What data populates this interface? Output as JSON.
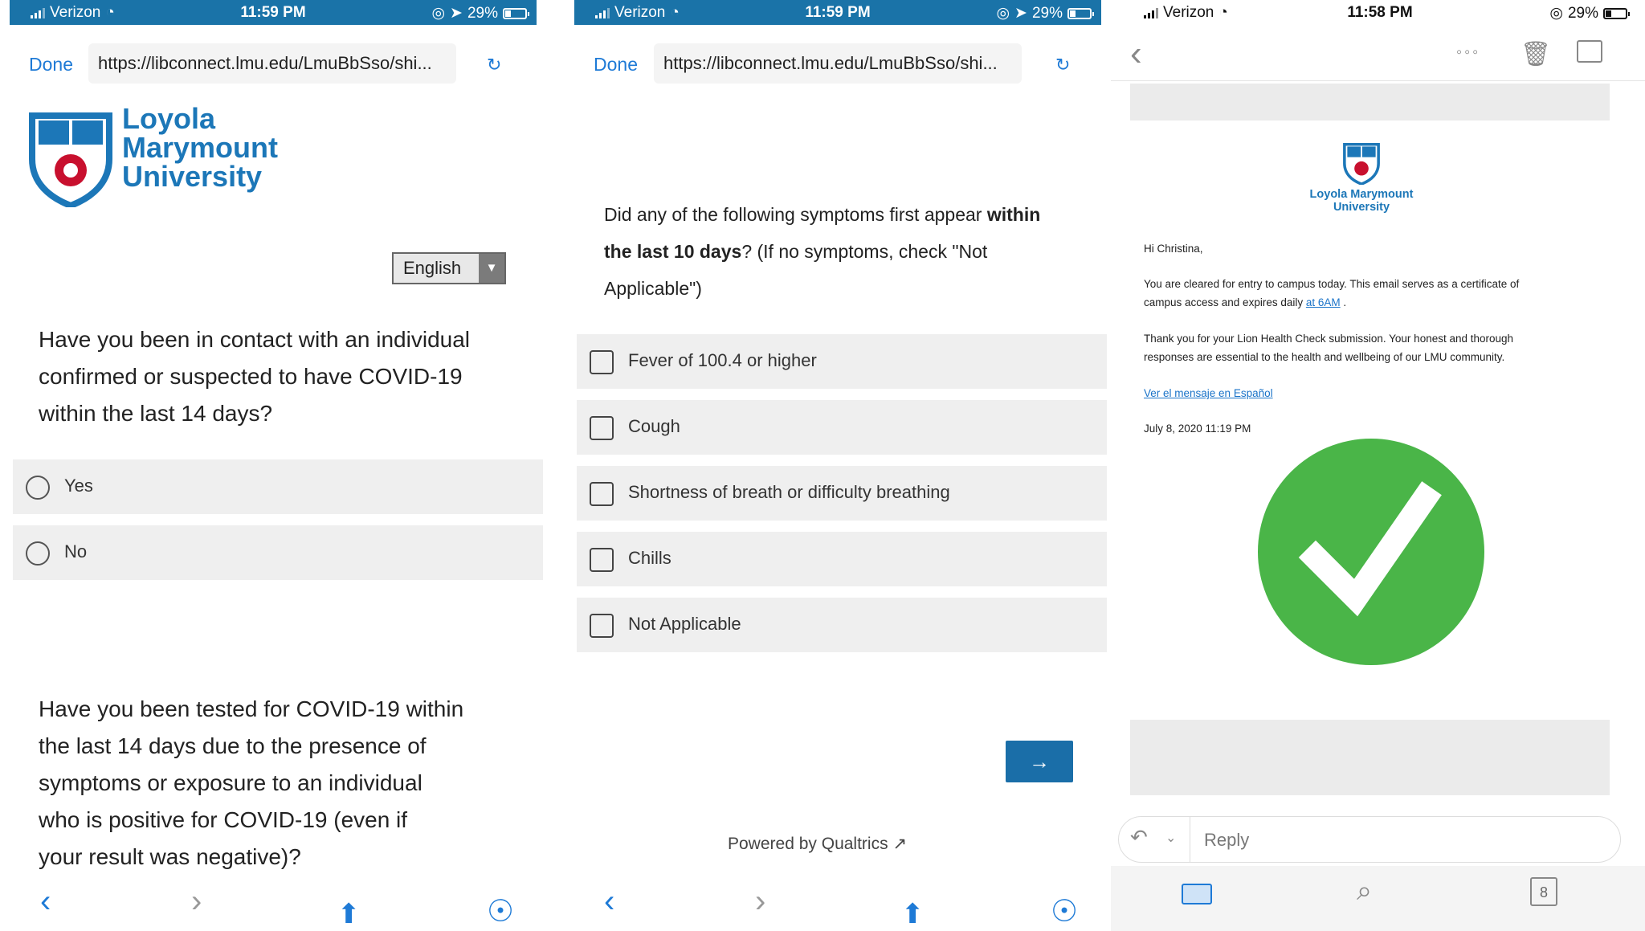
{
  "status_left": {
    "carrier": "Verizon",
    "time": "11:59 PM",
    "battery": "29%"
  },
  "status_mid": {
    "carrier": "Verizon",
    "time": "11:59 PM",
    "battery": "29%"
  },
  "status_right": {
    "carrier": "Verizon",
    "time": "11:58 PM",
    "battery": "29%"
  },
  "browser": {
    "done_label": "Done",
    "url": "https://libconnect.lmu.edu/LmuBbSso/shi..."
  },
  "logo": {
    "line1": "Loyola",
    "line2": "Marymount",
    "line3": "University"
  },
  "language": {
    "selected": "English"
  },
  "survey1": {
    "q1": {
      "lines": [
        "Have you been in contact with an individual",
        "confirmed or suspected to have COVID-19",
        "within the last 14 days?"
      ]
    },
    "q1_options": [
      "Yes",
      "No"
    ],
    "q2": {
      "lines": [
        "Have you been tested for COVID-19 within",
        "the last 14 days due to the presence of",
        "symptoms or exposure to an individual",
        "who is positive for COVID-19 (even if",
        "your result was negative)?"
      ]
    }
  },
  "survey2": {
    "q_part1": "Did any of the following symptoms first appear",
    "q_bold1": "within",
    "q_bold2": "the last 10 days",
    "q_part2": "? (If no symptoms, check \"Not",
    "q_part3": "Applicable\")",
    "options": [
      "Fever of 100.4 or higher",
      "Cough",
      "Shortness of breath or difficulty breathing",
      "Chills",
      "Not Applicable"
    ],
    "next_label": "→",
    "powered": "Powered by Qualtrics"
  },
  "email": {
    "logo_line1": "Loyola Marymount",
    "logo_line2": "University",
    "greeting": "Hi Christina,",
    "para1_a": "You are cleared for entry to campus today. This email serves as a certificate of",
    "para1_b": "campus access and expires daily",
    "para1_link": "at 6AM",
    "para1_end": ".",
    "para2_a": "Thank you for your Lion Health Check submission. Your honest and thorough",
    "para2_b": "responses are essential to the health and wellbeing of our LMU community.",
    "spanish_link": "Ver el mensaje en Español",
    "date": "July 8, 2020 11:19 PM",
    "reply_label": "Reply",
    "calendar_day": "8"
  },
  "colors": {
    "accent": "#1e7ad6",
    "lmu_blue": "#1c77b8",
    "check_green": "#4ab548",
    "status_blue": "#1a73a8"
  }
}
